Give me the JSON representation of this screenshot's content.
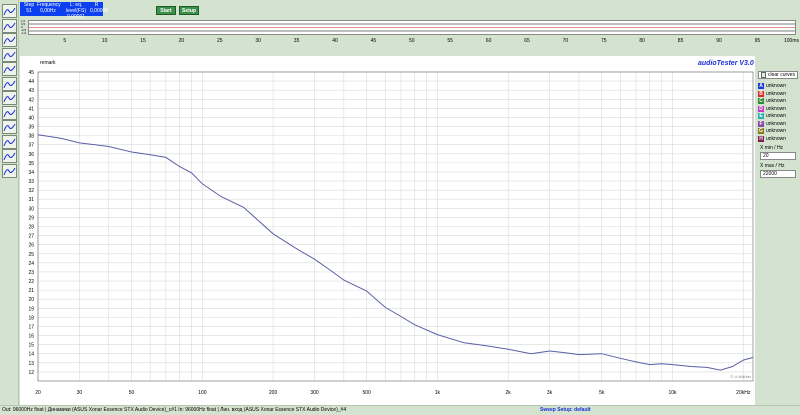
{
  "toolbar": {
    "start_label": "Start",
    "setup_label": "Setup",
    "tool_icons": [
      "sweep-icon",
      "sine-icon",
      "wave-icon",
      "spectrum-icon",
      "filter-icon",
      "tsp-icon",
      "impulse-icon",
      "distortion-icon",
      "settings-icon",
      "noise-icon",
      "curve-icon",
      "gauge-icon"
    ]
  },
  "readout": {
    "step_label": "Step",
    "step_value": "51",
    "freq_label": "Frequency",
    "freq_value": "0,00Hz",
    "l_label": "L: eq. level(FS)",
    "l_value": "0,00001",
    "r_label": "R",
    "r_value": "0,00006"
  },
  "time_scale": {
    "ticks": [
      "5",
      "10",
      "15",
      "20",
      "25",
      "30",
      "35",
      "40",
      "45",
      "50",
      "55",
      "60",
      "65",
      "70",
      "75",
      "80",
      "85",
      "90",
      "95"
    ],
    "end_label": "100ms",
    "y_labels": [
      "1,0",
      "0,5",
      "0",
      "-0,5",
      "-1,0"
    ]
  },
  "plot": {
    "remark": "remark",
    "logo": "audioTester  V3.0",
    "watermark": "© U.Wähler"
  },
  "right_panel": {
    "clear_curves": "clear curves",
    "curves": [
      {
        "letter": "A",
        "label": "unknown",
        "color": "#1d3ad8"
      },
      {
        "letter": "B",
        "label": "unknown",
        "color": "#d8262b"
      },
      {
        "letter": "C",
        "label": "unknown",
        "color": "#2e8a35"
      },
      {
        "letter": "D",
        "label": "unknown",
        "color": "#c23ac8"
      },
      {
        "letter": "E",
        "label": "unknown",
        "color": "#2ab0b0"
      },
      {
        "letter": "F",
        "label": "unknown",
        "color": "#8a4aa5"
      },
      {
        "letter": "G",
        "label": "unknown",
        "color": "#8a7a20"
      },
      {
        "letter": "H",
        "label": "unknown",
        "color": "#7a2050"
      }
    ],
    "xmin_label": "X min / Hz",
    "xmin_value": "20",
    "xmax_label": "X max / Hz",
    "xmax_value": "22000"
  },
  "status": {
    "left": "Out: 96000Hz float  | Динамики (ASUS Xonar Essence STX Audio Device)_c#1  In: 96000Hz float  | Лин. вход (ASUS Xonar Essence STX Audio Device)_#4",
    "mid": "Sweep  Setup: default"
  },
  "chart_data": {
    "type": "line",
    "xscale": "log",
    "xlim": [
      20,
      22000
    ],
    "ylim": [
      11,
      45
    ],
    "x_ticks": [
      {
        "v": 20,
        "l": "20"
      },
      {
        "v": 30,
        "l": "30"
      },
      {
        "v": 50,
        "l": "50"
      },
      {
        "v": 100,
        "l": "100"
      },
      {
        "v": 200,
        "l": "200"
      },
      {
        "v": 300,
        "l": "300"
      },
      {
        "v": 500,
        "l": "500"
      },
      {
        "v": 1000,
        "l": "1k"
      },
      {
        "v": 2000,
        "l": "2k"
      },
      {
        "v": 3000,
        "l": "3k"
      },
      {
        "v": 5000,
        "l": "5k"
      },
      {
        "v": 10000,
        "l": "10k"
      },
      {
        "v": 20000,
        "l": "20kHz"
      }
    ],
    "y_ticks": [
      12,
      13,
      14,
      15,
      16,
      17,
      18,
      19,
      20,
      21,
      22,
      23,
      24,
      25,
      26,
      27,
      28,
      29,
      30,
      31,
      32,
      33,
      34,
      35,
      36,
      37,
      38,
      39,
      40,
      41,
      42,
      43,
      44,
      45
    ],
    "series": [
      {
        "color": "#5b5fa8",
        "x": [
          20,
          25,
          30,
          35,
          40,
          50,
          60,
          70,
          80,
          90,
          100,
          120,
          150,
          200,
          250,
          300,
          350,
          400,
          500,
          600,
          700,
          800,
          1000,
          1300,
          1600,
          2000,
          2500,
          3000,
          3500,
          4000,
          5000,
          6000,
          7000,
          8000,
          9000,
          10000,
          12000,
          14000,
          16000,
          18000,
          20000,
          22000
        ],
        "y": [
          38.1,
          37.7,
          37.2,
          37.0,
          36.8,
          36.2,
          35.9,
          35.6,
          34.6,
          33.9,
          32.7,
          31.3,
          30.1,
          27.2,
          25.6,
          24.4,
          23.2,
          22.1,
          20.9,
          19.1,
          18.1,
          17.2,
          16.1,
          15.2,
          14.9,
          14.5,
          14.0,
          14.3,
          14.1,
          13.9,
          14.0,
          13.5,
          13.1,
          12.8,
          12.9,
          12.8,
          12.6,
          12.5,
          12.2,
          12.6,
          13.3,
          13.6
        ]
      }
    ]
  }
}
